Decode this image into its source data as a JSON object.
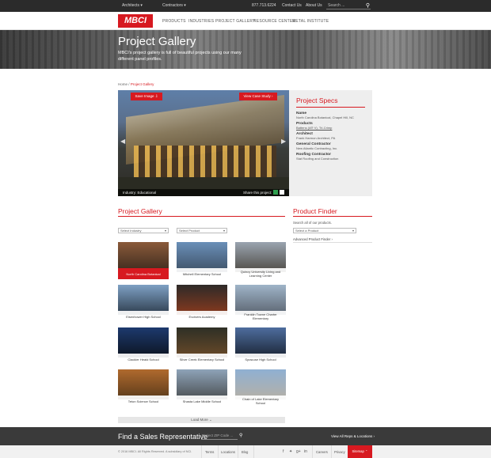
{
  "topbar": {
    "dropdowns": [
      {
        "label": "Architects"
      },
      {
        "label": "Contractors"
      }
    ],
    "phone": "877.713.6224",
    "contact": "Contact Us",
    "about": "About Us",
    "search_placeholder": "Search ..."
  },
  "nav": {
    "logo": "MBCI",
    "items": [
      "PRODUCTS",
      "INDUSTRIES",
      "PROJECT GALLERY",
      "RESOURCE CENTER",
      "METAL INSTITUTE"
    ]
  },
  "hero": {
    "title": "Project Gallery",
    "subtitle": "MBCI's project gallery is full of beautiful projects using our many different panel profiles."
  },
  "breadcrumb": {
    "home": "Home",
    "separator": "/",
    "current": "Project Gallery"
  },
  "feature": {
    "save_image": "Save Image",
    "view_case": "View Case Study",
    "industry": "Industry: Educational",
    "share": "Share this project:"
  },
  "specs": {
    "title": "Project Specs",
    "items": [
      {
        "label": "Name",
        "value": "North Carolina Botanical, Chapel Hill, NC"
      },
      {
        "label": "Products",
        "value": "Battens (A® V), Tri-Crimp"
      },
      {
        "label": "Architect",
        "value": "Frank Harmon Architect, PA"
      },
      {
        "label": "General Contractor",
        "value": "New Atlantic Contracting, Inc."
      },
      {
        "label": "Roofing Contractor",
        "value": "Stat Roofing and Construction"
      }
    ]
  },
  "gallery": {
    "title": "Project Gallery",
    "industry_select": "Select Industry",
    "product_select": "Select Product",
    "tiles": [
      {
        "caption": "North Carolina Botanical",
        "colors": [
          "#8a5a3a",
          "#3c2a1e"
        ]
      },
      {
        "caption": "Mitchell Elementary School",
        "colors": [
          "#6a8fb8",
          "#3e5166"
        ]
      },
      {
        "caption": "Quincy University Living and Learning Center",
        "colors": [
          "#9aa4b0",
          "#4e4a44"
        ]
      },
      {
        "caption": "Eisenhower High School",
        "colors": [
          "#7ea0c4",
          "#2d3c4c"
        ]
      },
      {
        "caption": "Evolvers Academy",
        "colors": [
          "#2e2a28",
          "#8a3a1e"
        ]
      },
      {
        "caption": "Franklin Towne Charter Elementary",
        "colors": [
          "#9fb4c8",
          "#5b6470"
        ]
      },
      {
        "caption": "Clackler Heald School",
        "colors": [
          "#1d3a6e",
          "#0c1320"
        ]
      },
      {
        "caption": "Silver Creek Elementary School",
        "colors": [
          "#2e2f26",
          "#6a4a28"
        ]
      },
      {
        "caption": "Syracuse High School",
        "colors": [
          "#4e6d9e",
          "#1b2535"
        ]
      },
      {
        "caption": "Teton Science School",
        "colors": [
          "#b06a2e",
          "#5a3a1a"
        ]
      },
      {
        "caption": "Shasta Lake Middle School",
        "colors": [
          "#8ea3b8",
          "#4b4f52"
        ]
      },
      {
        "caption": "Chain of Lake Elementary School",
        "colors": [
          "#8fb0d2",
          "#b5b0a6"
        ]
      }
    ],
    "load_more": "Load More"
  },
  "finder": {
    "title": "Product Finder",
    "text": "Search all of our products.",
    "select": "Select a Product",
    "advanced": "Advanced Product Finder"
  },
  "footer": {
    "sales_title": "Find a Sales Representative",
    "zip_placeholder": "Project ZIP Code ...",
    "all_reps": "View All Reps & Locations",
    "copyright": "© 2016 MBCI. All Rights Reserved. A subsidiary of NCI.",
    "links": [
      "Terms",
      "Locations",
      "Blog"
    ],
    "careers": "Careers",
    "privacy": "Privacy",
    "sitemap": "Sitemap"
  },
  "colors": {
    "accent": "#d71920",
    "dark": "#2b2b2b"
  }
}
